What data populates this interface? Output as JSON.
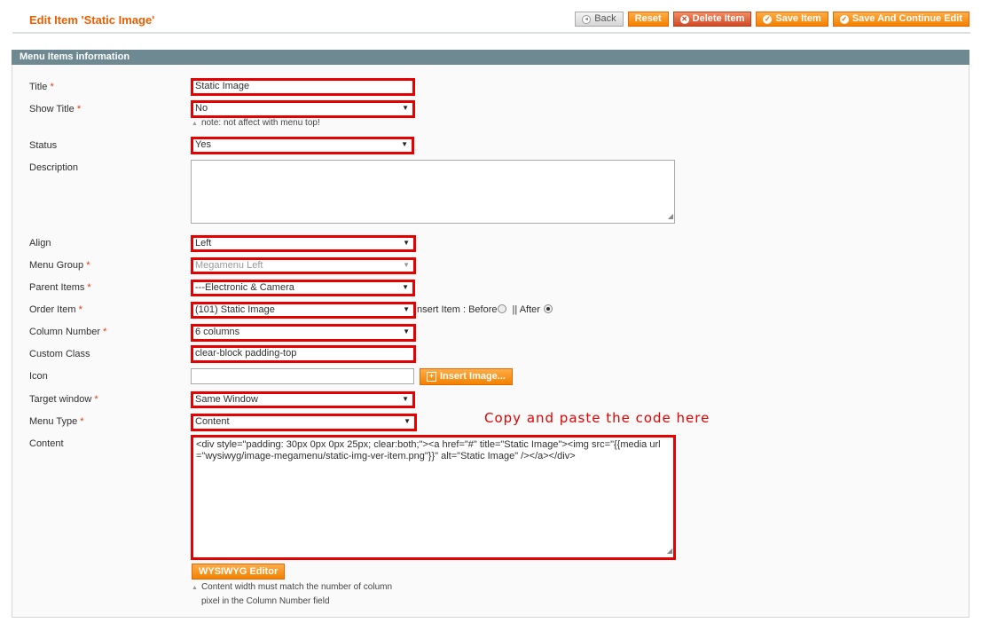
{
  "page": {
    "title": "Edit Item 'Static Image'"
  },
  "actions": {
    "back": "Back",
    "reset": "Reset",
    "delete": "Delete Item",
    "save": "Save Item",
    "save_continue": "Save And Continue Edit"
  },
  "fieldset": {
    "legend": "Menu Items information"
  },
  "form": {
    "title": {
      "label": "Title",
      "value": "Static Image"
    },
    "show_title": {
      "label": "Show Title",
      "value": "No",
      "note": "note: not affect with menu top!"
    },
    "status": {
      "label": "Status",
      "value": "Yes"
    },
    "description": {
      "label": "Description",
      "value": ""
    },
    "align": {
      "label": "Align",
      "value": "Left"
    },
    "menu_group": {
      "label": "Menu Group",
      "value": "Megamenu Left"
    },
    "parent_items": {
      "label": "Parent Items",
      "value": "---Electronic & Camera"
    },
    "order_item": {
      "label": "Order Item",
      "value": "(101) Static Image",
      "insert_label": "nsert Item : Before",
      "after_label": "|| After",
      "selected": "After"
    },
    "column_number": {
      "label": "Column Number",
      "value": "6 columns"
    },
    "custom_class": {
      "label": "Custom Class",
      "value": "clear-block padding-top"
    },
    "icon": {
      "label": "Icon",
      "value": "",
      "button": "Insert Image..."
    },
    "target_window": {
      "label": "Target window",
      "value": "Same Window"
    },
    "menu_type": {
      "label": "Menu Type",
      "value": "Content"
    },
    "content": {
      "label": "Content",
      "value": "<div style=\"padding: 30px 0px 0px 25px; clear:both;\"><a href=\"#\" title=\"Static Image\"><img src=\"{{media url=\"wysiwyg/image-megamenu/static-img-ver-item.png\"}}\" alt=\"Static Image\" /></a></div>",
      "editor_button": "WYSIWYG Editor",
      "note_line1": "Content width must match the number of column",
      "note_line2": "pixel in the Column Number field"
    }
  },
  "annotation": {
    "text": "Copy and paste the code here",
    "color": "#e60000"
  },
  "colors": {
    "accent": "#eb5e00",
    "highlight_border": "#e60000",
    "header_bar": "#6f8992",
    "button_orange": "#f18200"
  }
}
